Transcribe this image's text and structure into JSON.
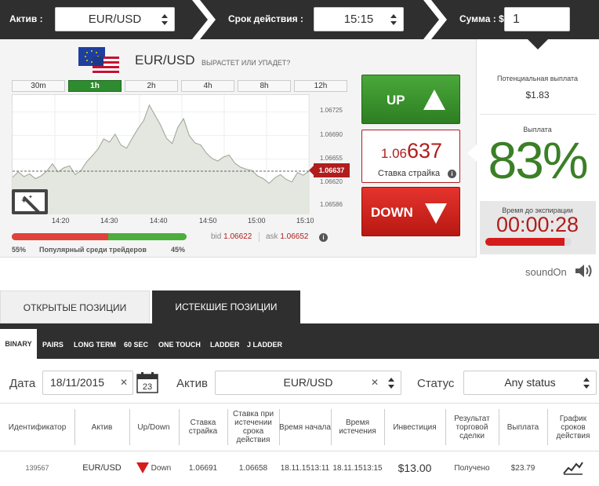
{
  "topbar": {
    "asset_label": "Актив :",
    "asset_value": "EUR/USD",
    "expiry_label": "Срок действия :",
    "expiry_value": "15:15",
    "amount_label": "Сумма : $",
    "amount_value": "1"
  },
  "instrument": {
    "pair": "EUR/USD",
    "question": "ВЫРАСТЕТ ИЛИ УПАДЕТ?",
    "flag_icon": "eu-us-flag-icon"
  },
  "timeframes": [
    "30m",
    "1h",
    "2h",
    "4h",
    "8h",
    "12h"
  ],
  "active_timeframe": "1h",
  "chart_data": {
    "type": "area",
    "x_ticks": [
      "14:20",
      "14:30",
      "14:40",
      "14:50",
      "15:00",
      "15:10"
    ],
    "y_ticks": [
      "1.06725",
      "1.06690",
      "1.06655",
      "1.06620",
      "1.06586"
    ],
    "ylim": [
      1.06573,
      1.0675
    ],
    "current_price": "1.06637",
    "current_value": 1.06637,
    "series": [
      {
        "values": [
          1.06628,
          1.06636,
          1.06629,
          1.06633,
          1.06626,
          1.0663,
          1.06637,
          1.06648,
          1.06636,
          1.06642,
          1.06645,
          1.06632,
          1.06638,
          1.06651,
          1.0666,
          1.0667,
          1.06685,
          1.0668,
          1.06692,
          1.06676,
          1.06671,
          1.06686,
          1.067,
          1.06712,
          1.06735,
          1.0672,
          1.06705,
          1.06686,
          1.06678,
          1.06702,
          1.06715,
          1.0669,
          1.06679,
          1.06676,
          1.06664,
          1.06656,
          1.06652,
          1.06658,
          1.06661,
          1.06649,
          1.06643,
          1.0664,
          1.06638,
          1.0663,
          1.06626,
          1.06619,
          1.06627,
          1.06632,
          1.06625,
          1.06621,
          1.06635,
          1.06631,
          1.06637
        ]
      }
    ]
  },
  "sentiment": {
    "down_pct": 55,
    "up_pct": 45,
    "left_label": "55%",
    "center_label": "Популярный среди трейдеров",
    "right_label": "45%"
  },
  "quotes": {
    "bid_label": "bid",
    "bid_value": "1.06622",
    "ask_label": "ask",
    "ask_value": "1.06652"
  },
  "trade": {
    "up_label": "UP",
    "down_label": "DOWN",
    "strike_prefix": "1.06",
    "strike_suffix": "637",
    "strike_label": "Ставка страйка"
  },
  "payout": {
    "potential_label": "Потенциальная выплата",
    "potential_value": "$1.83",
    "payout_label": "Выплата",
    "payout_pct": "83%",
    "expiry_label": "Время до экспирации",
    "timer": "00:00:28",
    "timer_progress": 0.92
  },
  "sound": {
    "label": "soundOn"
  },
  "tabs": {
    "open": "ОТКРЫТЫЕ ПОЗИЦИИ",
    "expired": "ИСТЕКШИЕ ПОЗИЦИИ"
  },
  "subtabs": [
    "BINARY",
    "PAIRS",
    "LONG TERM",
    "60 SEC",
    "ONE TOUCH",
    "LADDER",
    "J LADDER"
  ],
  "filters": {
    "date_label": "Дата",
    "date_value": "18/11/2015",
    "calendar_day": "23",
    "asset_label": "Актив",
    "asset_value": "EUR/USD",
    "status_label": "Статус",
    "status_value": "Any status"
  },
  "table": {
    "columns": [
      "Идентификатор",
      "Актив",
      "Up/Down",
      "Ставка страйка",
      "Ставка при истечении срока действия",
      "Время начала",
      "Время истечения",
      "Инвестиция",
      "Результат торговой сделки",
      "Выплата",
      "График сроков действия"
    ],
    "rows": [
      {
        "id": "139567",
        "asset": "EUR/USD",
        "direction": "Down",
        "strike": "1.06691",
        "expiry_rate": "1.06658",
        "start_date": "18.11.15",
        "start_time": "13:11",
        "end_date": "18.11.15",
        "end_time": "13:15",
        "investment": "$13.00",
        "result": "Получено",
        "payout": "$23.79"
      }
    ]
  },
  "colors": {
    "up_green": "#2d7e22",
    "down_red": "#b81812",
    "payout_green": "#3b7f26",
    "timer_red": "#b11d1d",
    "dark_bar": "#2f2f2f"
  }
}
